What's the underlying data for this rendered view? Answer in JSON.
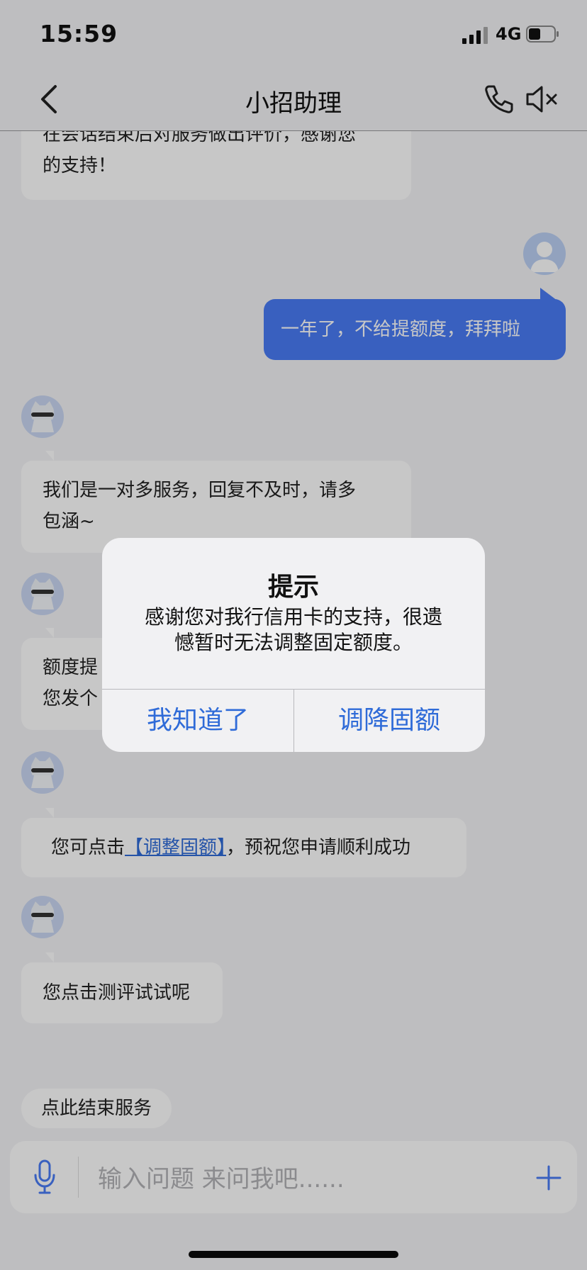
{
  "status_bar": {
    "time": "15:59",
    "network": "4G"
  },
  "nav": {
    "title": "小招助理"
  },
  "messages": {
    "m0": {
      "line1": "在会话结束后对服务做出评价，感谢您",
      "line2": "的支持！"
    },
    "m1": {
      "text": "一年了，不给提额度，拜拜啦"
    },
    "m2": {
      "line1": "我们是一对多服务，回复不及时，请多",
      "line2": "包涵~"
    },
    "m3": {
      "line1": "额度提",
      "line2": "您发个"
    },
    "m4": {
      "prefix": "您可点击",
      "link": "【调整固额】",
      "suffix": "，预祝您申请顺利成功"
    },
    "m5": {
      "text": "您点击测评试试呢"
    }
  },
  "end_service": {
    "label": "点此结束服务"
  },
  "input": {
    "placeholder": "输入问题 来问我吧......"
  },
  "alert": {
    "title": "提示",
    "message_line1": "感谢您对我行信用卡的支持，很遗",
    "message_line2": "憾暂时无法调整固定额度。",
    "button_ok": "我知道了",
    "button_reduce": "调降固额"
  },
  "colors": {
    "accent": "#2f6bd8",
    "user_bubble": "#4a7cf5",
    "background": "#f4f4f6"
  }
}
